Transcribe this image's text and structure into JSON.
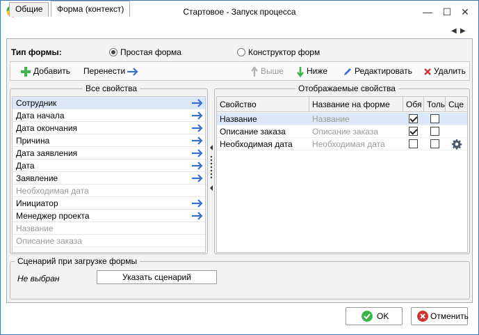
{
  "window": {
    "title": "Стартовое - Запуск процесса"
  },
  "tabs": [
    {
      "label": "Общие"
    },
    {
      "label": "Форма (контекст)"
    }
  ],
  "form_type": {
    "label": "Тип формы:",
    "options": [
      {
        "label": "Простая форма",
        "checked": true
      },
      {
        "label": "Конструктор форм",
        "checked": false
      }
    ]
  },
  "toolbar": {
    "add": "Добавить",
    "move": "Перенести",
    "up": "Выше",
    "down": "Ниже",
    "edit": "Редактировать",
    "delete": "Удалить"
  },
  "all_properties": {
    "title": "Все свойства",
    "items": [
      {
        "label": "Сотрудник",
        "selected": true,
        "enabled": true
      },
      {
        "label": "Дата начала",
        "selected": false,
        "enabled": true
      },
      {
        "label": "Дата окончания",
        "selected": false,
        "enabled": true
      },
      {
        "label": "Причина",
        "selected": false,
        "enabled": true
      },
      {
        "label": "Дата заявления",
        "selected": false,
        "enabled": true
      },
      {
        "label": "Дата",
        "selected": false,
        "enabled": true
      },
      {
        "label": "Заявление",
        "selected": false,
        "enabled": true
      },
      {
        "label": "Необходимая дата",
        "selected": false,
        "enabled": false
      },
      {
        "label": "Инициатор",
        "selected": false,
        "enabled": true
      },
      {
        "label": "Менеджер проекта",
        "selected": false,
        "enabled": true
      },
      {
        "label": "Название",
        "selected": false,
        "enabled": false
      },
      {
        "label": "Описание заказа",
        "selected": false,
        "enabled": false
      }
    ]
  },
  "displayed_properties": {
    "title": "Отображаемые свойства",
    "columns": [
      "Свойство",
      "Название на форме",
      "Обя",
      "Толь",
      "Сце"
    ],
    "rows": [
      {
        "property": "Название",
        "form_name": "Название",
        "required": true,
        "readonly": false,
        "scenario": false,
        "selected": true
      },
      {
        "property": "Описание заказа",
        "form_name": "Описание заказа",
        "required": true,
        "readonly": false,
        "scenario": false,
        "selected": false
      },
      {
        "property": "Необходимая дата",
        "form_name": "Необходимая дата",
        "required": false,
        "readonly": false,
        "scenario": true,
        "selected": false
      }
    ]
  },
  "scenario": {
    "title": "Сценарий при загрузке формы",
    "value": "Не выбран",
    "button": "Указать сценарий"
  },
  "buttons": {
    "ok": "OK",
    "cancel": "Отменить"
  },
  "colors": {
    "accent": "#3c78b4",
    "selection": "#dce8f8",
    "ok_green": "#3cb44a",
    "cancel_red": "#d23232",
    "arrow_blue": "#3a6fd0"
  }
}
